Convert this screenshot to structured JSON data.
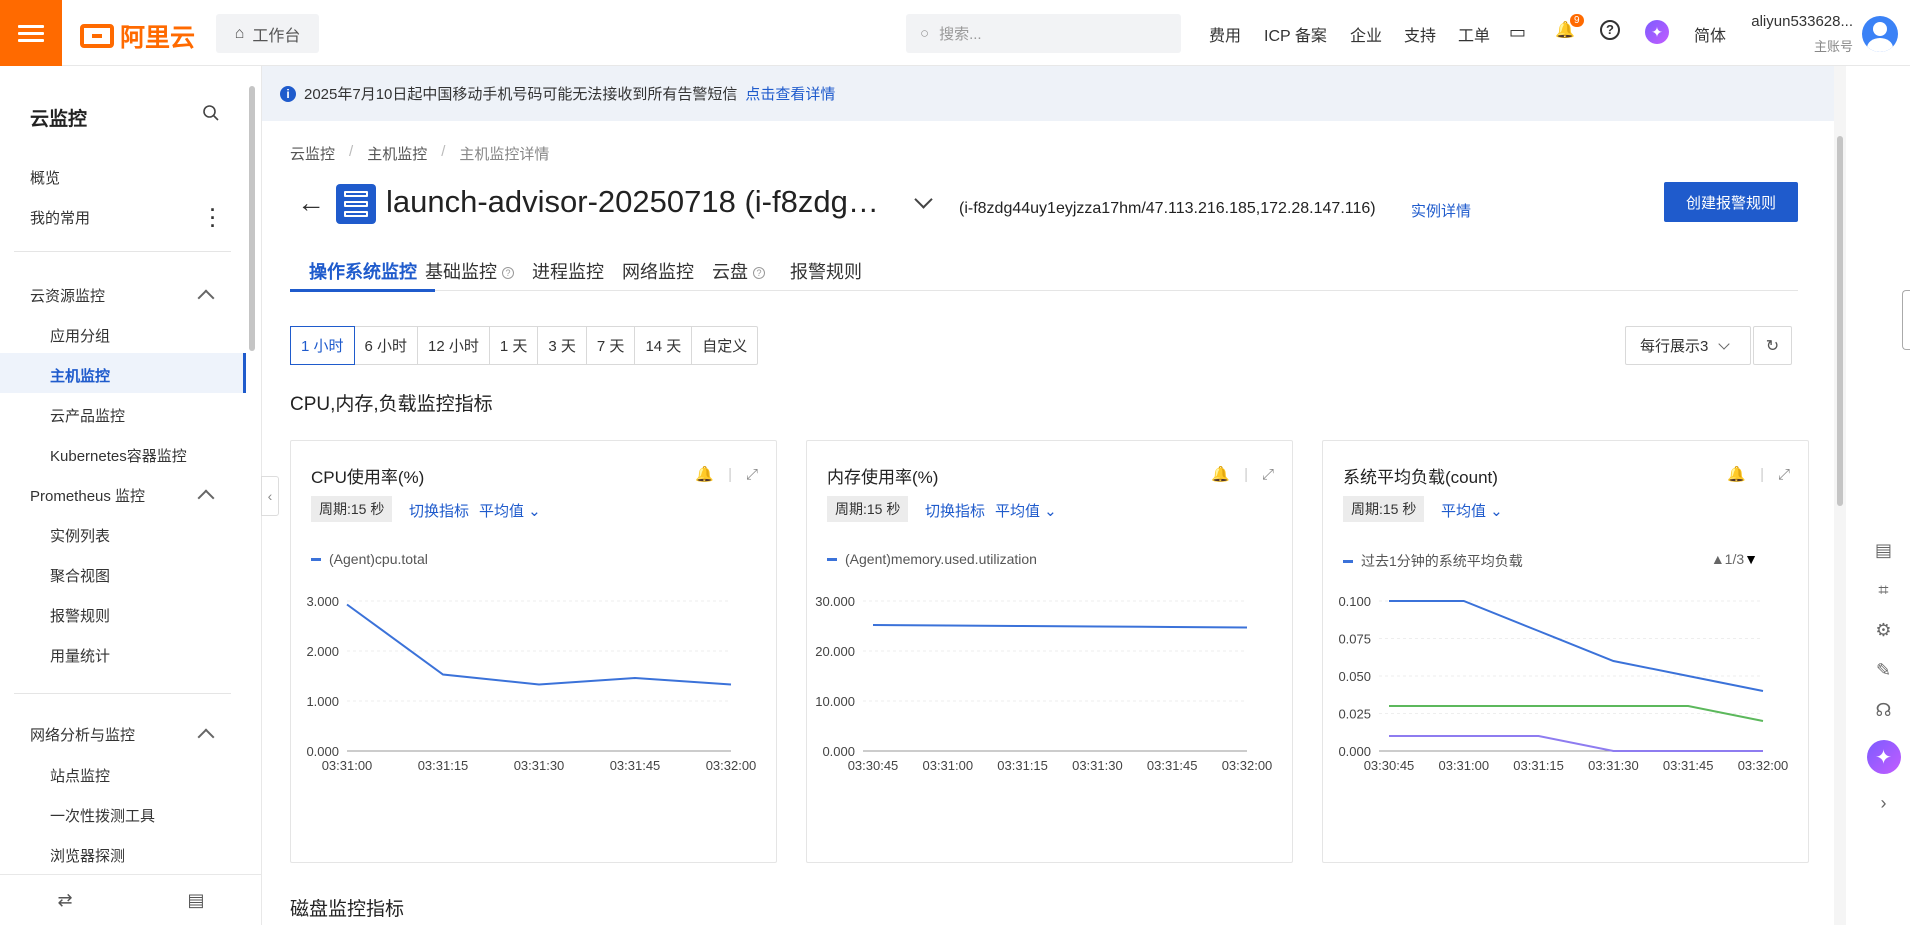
{
  "topbar": {
    "logo": "阿里云",
    "workbench": "工作台",
    "search_placeholder": "搜索...",
    "nav": [
      "费用",
      "ICP 备案",
      "企业",
      "支持",
      "工单"
    ],
    "notif_count": "9",
    "lang": "简体",
    "user_name": "aliyun533628...",
    "user_role": "主账号"
  },
  "sidebar": {
    "title": "云监控",
    "items": [
      {
        "label": "概览"
      },
      {
        "label": "我的常用"
      },
      {
        "label": "云资源监控"
      },
      {
        "label": "应用分组"
      },
      {
        "label": "主机监控"
      },
      {
        "label": "云产品监控"
      },
      {
        "label": "Kubernetes容器监控"
      },
      {
        "label": "Prometheus 监控"
      },
      {
        "label": "实例列表"
      },
      {
        "label": "聚合视图"
      },
      {
        "label": "报警规则"
      },
      {
        "label": "用量统计"
      },
      {
        "label": "网络分析与监控"
      },
      {
        "label": "站点监控"
      },
      {
        "label": "一次性拨测工具"
      },
      {
        "label": "浏览器探测"
      }
    ]
  },
  "notice": {
    "text": "2025年7月10日起中国移动手机号码可能无法接收到所有告警短信",
    "link": "点击查看详情"
  },
  "breadcrumb": [
    "云监控",
    "主机监控",
    "主机监控详情"
  ],
  "header": {
    "title": "launch-advisor-20250718 (i-f8zdg…",
    "instance_info": "(i-f8zdg44uy1eyjzza17hm/47.113.216.185,172.28.147.116)",
    "instance_link": "实例详情",
    "create_button": "创建报警规则"
  },
  "tabs": [
    "操作系统监控",
    "基础监控",
    "进程监控",
    "网络监控",
    "云盘",
    "报警规则"
  ],
  "time_ranges": [
    "1 小时",
    "6 小时",
    "12 小时",
    "1 天",
    "3 天",
    "7 天",
    "14 天",
    "自定义"
  ],
  "per_row": "每行展示3",
  "section_title": "CPU,内存,负载监控指标",
  "section2_title": "磁盘监控指标",
  "cards": [
    {
      "title": "CPU使用率(%)",
      "period": "周期:15 秒",
      "switch": "切换指标",
      "agg": "平均值",
      "legend": "(Agent)cpu.total"
    },
    {
      "title": "内存使用率(%)",
      "period": "周期:15 秒",
      "switch": "切换指标",
      "agg": "平均值",
      "legend": "(Agent)memory.used.utilization"
    },
    {
      "title": "系统平均负载(count)",
      "period": "周期:15 秒",
      "agg": "平均值",
      "legend": "过去1分钟的系统平均负载",
      "pager": "1/3"
    }
  ],
  "chart_data": [
    {
      "type": "line",
      "title": "CPU使用率(%)",
      "x": [
        "03:31:00",
        "03:31:15",
        "03:31:30",
        "03:31:45",
        "03:32:00"
      ],
      "y_ticks": [
        "0.000",
        "1.000",
        "2.000",
        "3.000"
      ],
      "ylim": [
        0,
        3
      ],
      "series": [
        {
          "name": "(Agent)cpu.total",
          "color": "#3b72d9",
          "values": [
            2.93,
            1.53,
            1.33,
            1.46,
            1.33
          ]
        }
      ]
    },
    {
      "type": "line",
      "title": "内存使用率(%)",
      "x": [
        "03:30:45",
        "03:31:00",
        "03:31:15",
        "03:31:30",
        "03:31:45",
        "03:32:00"
      ],
      "y_ticks": [
        "0.000",
        "10.000",
        "20.000",
        "30.000"
      ],
      "ylim": [
        0,
        30
      ],
      "series": [
        {
          "name": "(Agent)memory.used.utilization",
          "color": "#3b72d9",
          "values": [
            25.2,
            25.1,
            25.0,
            24.9,
            24.8,
            24.7
          ]
        }
      ]
    },
    {
      "type": "line",
      "title": "系统平均负载(count)",
      "x": [
        "03:30:45",
        "03:31:00",
        "03:31:15",
        "03:31:30",
        "03:31:45",
        "03:32:00"
      ],
      "y_ticks": [
        "0.000",
        "0.025",
        "0.050",
        "0.075",
        "0.100"
      ],
      "ylim": [
        0,
        0.1
      ],
      "series": [
        {
          "name": "过去1分钟的系统平均负载",
          "color": "#3b72d9",
          "values": [
            0.1,
            0.1,
            0.08,
            0.06,
            0.05,
            0.04
          ]
        },
        {
          "color": "#5cb85c",
          "values": [
            0.03,
            0.03,
            0.03,
            0.03,
            0.03,
            0.02
          ]
        },
        {
          "color": "#8e7cf0",
          "values": [
            0.01,
            0.01,
            0.01,
            0.0,
            0.0,
            0.0
          ]
        }
      ]
    }
  ]
}
